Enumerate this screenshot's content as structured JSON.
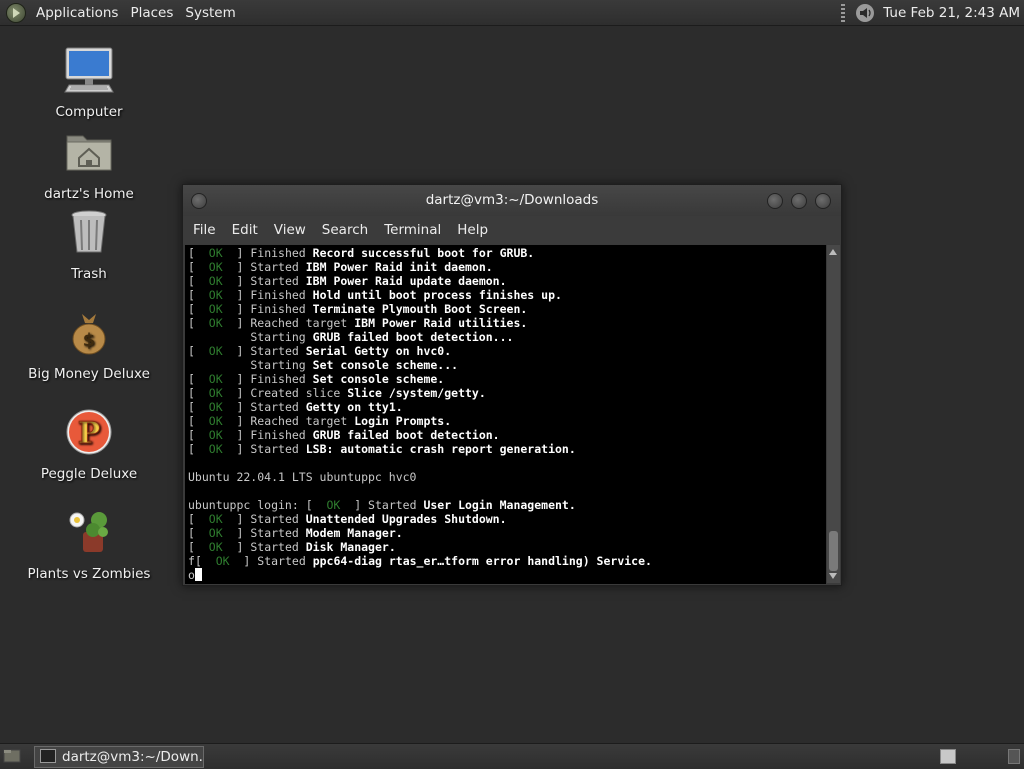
{
  "top_panel": {
    "menus": [
      "Applications",
      "Places",
      "System"
    ],
    "clock": "Tue Feb 21,  2:43 AM"
  },
  "desktop_icons": [
    {
      "label": "Computer",
      "icon": "computer-icon"
    },
    {
      "label": "dartz's Home",
      "icon": "home-folder-icon"
    },
    {
      "label": "Trash",
      "icon": "trash-icon"
    },
    {
      "label": "Big Money Deluxe",
      "icon": "money-bag-icon"
    },
    {
      "label": "Peggle Deluxe",
      "icon": "peggle-icon"
    },
    {
      "label": "Plants vs Zombies",
      "icon": "plants-icon"
    }
  ],
  "window": {
    "title": "dartz@vm3:~/Downloads",
    "menu": [
      "File",
      "Edit",
      "View",
      "Search",
      "Terminal",
      "Help"
    ]
  },
  "terminal": {
    "ok_text": "OK",
    "lines": [
      {
        "ok": true,
        "verb": "Finished",
        "target": "Record successful boot for GRUB."
      },
      {
        "ok": true,
        "verb": "Started",
        "target": "IBM Power Raid init daemon."
      },
      {
        "ok": true,
        "verb": "Started",
        "target": "IBM Power Raid update daemon."
      },
      {
        "ok": true,
        "verb": "Finished",
        "target": "Hold until boot process finishes up."
      },
      {
        "ok": true,
        "verb": "Finished",
        "target": "Terminate Plymouth Boot Screen."
      },
      {
        "ok": true,
        "verb": "Reached target",
        "target": "IBM Power Raid utilities."
      },
      {
        "ok": false,
        "verb": "Starting",
        "target": "GRUB failed boot detection..."
      },
      {
        "ok": true,
        "verb": "Started",
        "target": "Serial Getty on hvc0."
      },
      {
        "ok": false,
        "verb": "Starting",
        "target": "Set console scheme..."
      },
      {
        "ok": true,
        "verb": "Finished",
        "target": "Set console scheme."
      },
      {
        "ok": true,
        "verb": "Created slice",
        "target": "Slice /system/getty."
      },
      {
        "ok": true,
        "verb": "Started",
        "target": "Getty on tty1."
      },
      {
        "ok": true,
        "verb": "Reached target",
        "target": "Login Prompts."
      },
      {
        "ok": true,
        "verb": "Finished",
        "target": "GRUB failed boot detection."
      },
      {
        "ok": true,
        "verb": "Started",
        "target": "LSB: automatic crash report generation."
      }
    ],
    "banner": "Ubuntu 22.04.1 LTS ubuntuppc hvc0",
    "login_prompt": "ubuntuppc login:",
    "login_status": {
      "verb": "Started",
      "target": "User Login Management."
    },
    "lines2": [
      {
        "verb": "Started",
        "target": "Unattended Upgrades Shutdown."
      },
      {
        "verb": "Started",
        "target": "Modem Manager."
      },
      {
        "verb": "Started",
        "target": "Disk Manager."
      }
    ],
    "last_prefix": "f",
    "last_line": {
      "verb": "Started",
      "target": "ppc64-diag rtas_er…tform error handling) Service."
    },
    "input_prefix": "o"
  },
  "taskbar": {
    "task_label": "dartz@vm3:~/Down..."
  }
}
